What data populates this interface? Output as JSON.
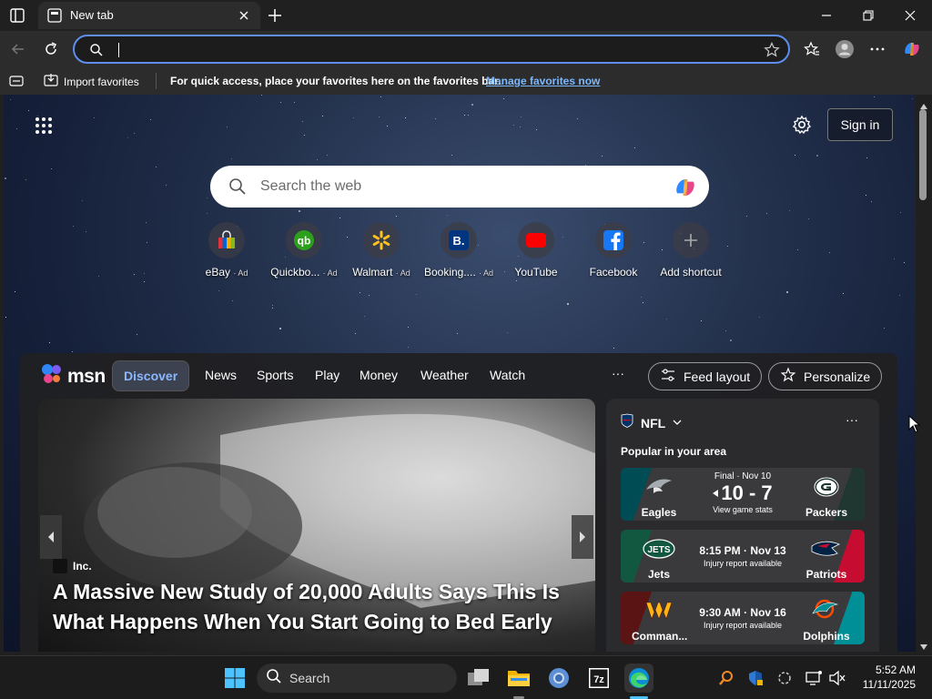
{
  "browser": {
    "tab_title": "New tab",
    "address_value": "",
    "favorites_bar": {
      "import_label": "Import favorites",
      "message": "For quick access, place your favorites here on the favorites bar.",
      "manage_link": "Manage favorites now"
    }
  },
  "newtab": {
    "sign_in": "Sign in",
    "search_placeholder": "Search the web",
    "shortcuts": [
      {
        "label": "eBay",
        "ad": "· Ad",
        "icon": "ebay-icon"
      },
      {
        "label": "Quickbo...",
        "ad": "· Ad",
        "icon": "quickbooks-icon"
      },
      {
        "label": "Walmart",
        "ad": "· Ad",
        "icon": "walmart-icon"
      },
      {
        "label": "Booking....",
        "ad": "· Ad",
        "icon": "booking-icon"
      },
      {
        "label": "YouTube",
        "ad": "",
        "icon": "youtube-icon"
      },
      {
        "label": "Facebook",
        "ad": "",
        "icon": "facebook-icon"
      },
      {
        "label": "Add shortcut",
        "ad": "",
        "icon": "plus-icon"
      }
    ]
  },
  "msn": {
    "logo_text": "msn",
    "nav": [
      "Discover",
      "News",
      "Sports",
      "Play",
      "Money",
      "Weather",
      "Watch"
    ],
    "more": "···",
    "feed_layout": "Feed layout",
    "personalize": "Personalize",
    "hero": {
      "source": "Inc.",
      "headline": "A Massive New Study of 20,000 Adults Says This Is What Happens When You Start Going to Bed Early"
    },
    "nfl": {
      "title": "NFL",
      "more": "···",
      "subtitle": "Popular in your area",
      "games": [
        {
          "team1": "Eagles",
          "team2": "Packers",
          "top": "Final · Nov 10",
          "main": "10 - 7",
          "sub": "View game stats",
          "c1": "#004c54",
          "c2": "#203731"
        },
        {
          "team1": "Jets",
          "team2": "Patriots",
          "top": "",
          "main": "8:15 PM · Nov 13",
          "sub": "Injury report available",
          "c1": "#125740",
          "c2": "#c60c30"
        },
        {
          "team1": "Comman...",
          "team2": "Dolphins",
          "top": "",
          "main": "9:30 AM · Nov 16",
          "sub": "Injury report available",
          "c1": "#5a1414",
          "c2": "#008e97"
        }
      ]
    }
  },
  "taskbar": {
    "search_label": "Search",
    "time": "5:52 AM",
    "date": "11/11/2025"
  }
}
